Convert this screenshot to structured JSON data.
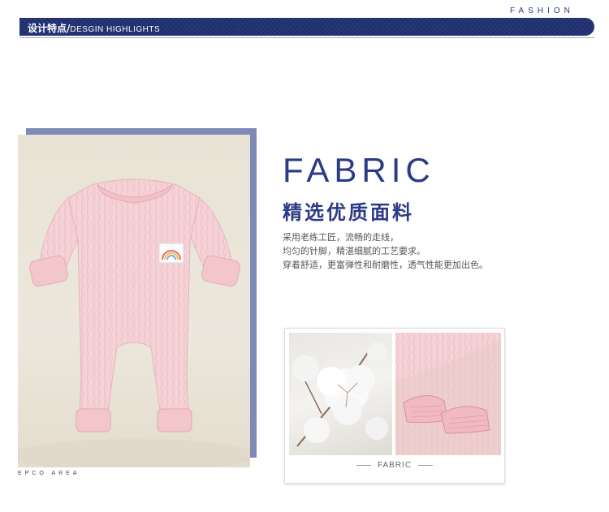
{
  "header": {
    "fashion": "FASHION",
    "banner_cn": "设计特点/",
    "banner_en": "DESGIN HIGHLIGHTS"
  },
  "photo": {
    "caption": "EPCO AREA"
  },
  "fabric": {
    "title": "FABRIC",
    "subtitle": "精选优质面料",
    "lines": [
      "采用老练工匠，流畅的走线，",
      "均匀的针脚，精湛细腻的工艺要求。",
      "穿着舒适，更富弹性和耐磨性，透气性能更加出色。"
    ]
  },
  "card": {
    "label": "FABRIC"
  },
  "colors": {
    "accent": "#1d2d6e",
    "title": "#2c3b85",
    "romper": "#f5cfd3"
  }
}
